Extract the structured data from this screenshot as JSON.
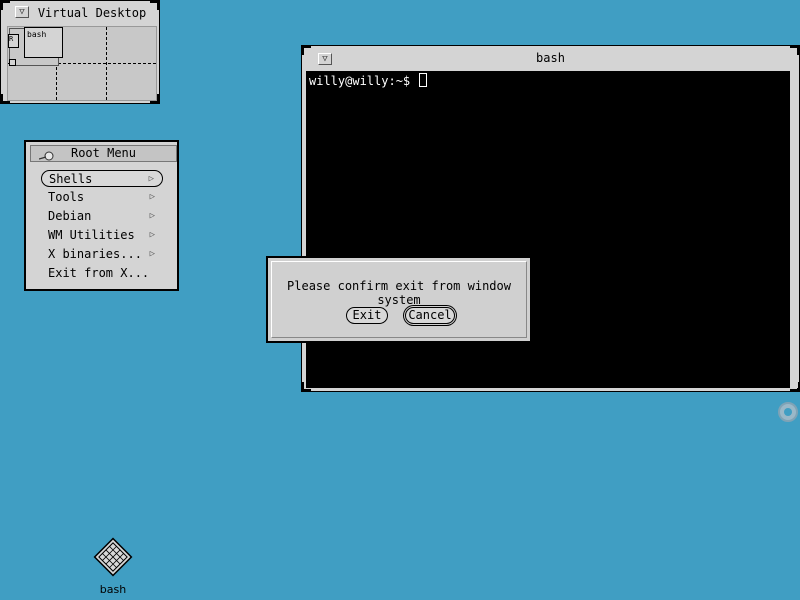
{
  "desktop": {
    "background": "#409ec3",
    "watermark_text": ""
  },
  "virtual_desktop": {
    "title": "Virtual Desktop",
    "mini_windows": [
      {
        "label": "bash"
      },
      {
        "label": "R"
      }
    ]
  },
  "root_menu": {
    "title": "Root Menu",
    "items": [
      {
        "label": "Shells",
        "has_submenu": true,
        "selected": true
      },
      {
        "label": "Tools",
        "has_submenu": true
      },
      {
        "label": "Debian",
        "has_submenu": true
      },
      {
        "label": "WM Utilities",
        "has_submenu": true
      },
      {
        "label": "X binaries...",
        "has_submenu": true
      },
      {
        "label": "Exit from X...",
        "has_submenu": false
      }
    ],
    "submenu_arrow": "▷"
  },
  "bash_window": {
    "title": "bash",
    "prompt": "willy@willy:~$ "
  },
  "exit_dialog": {
    "message": "Please confirm exit from window system",
    "buttons": {
      "exit": "Exit",
      "cancel": "Cancel"
    }
  },
  "desktop_icons": [
    {
      "label": "bash",
      "icon": "bash-window-icon"
    }
  ]
}
